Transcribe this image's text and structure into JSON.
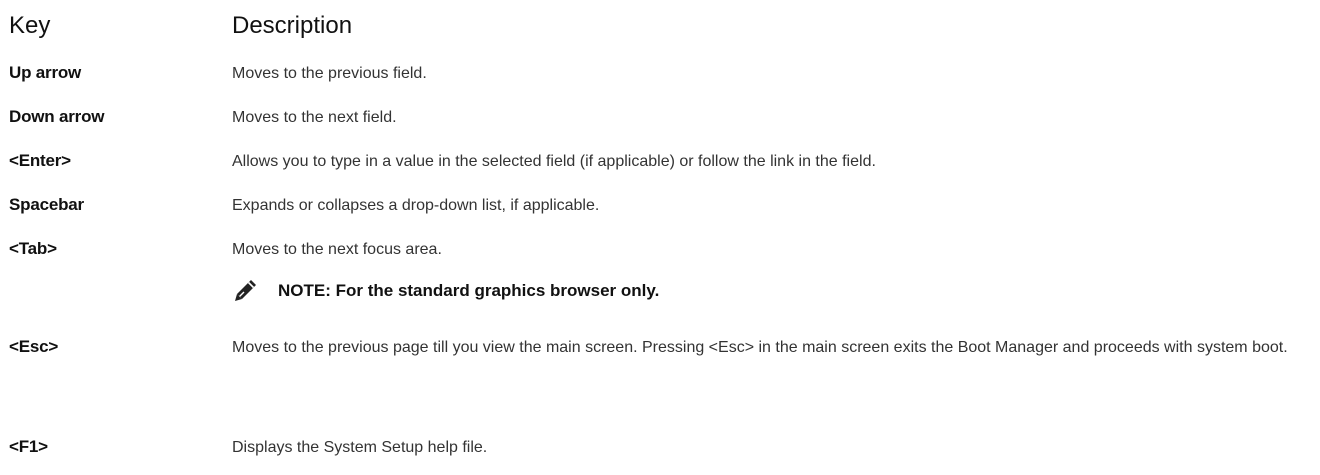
{
  "table": {
    "header": {
      "key": "Key",
      "description": "Description"
    },
    "rows": [
      {
        "key": "Up arrow",
        "description": "Moves to the previous field."
      },
      {
        "key": "Down arrow",
        "description": "Moves to the next field."
      },
      {
        "key": "<Enter>",
        "description": "Allows you to type in a value in the selected field (if applicable) or follow the link in the field."
      },
      {
        "key": "Spacebar",
        "description": "Expands or collapses a drop-down list, if applicable."
      },
      {
        "key": "<Tab>",
        "description": "Moves to the next focus area.",
        "note": "NOTE: For the standard graphics browser only."
      },
      {
        "key": "<Esc>",
        "description": "Moves to the previous page till you view the main screen. Pressing <Esc> in the main screen exits the Boot Manager and proceeds with system boot."
      },
      {
        "key": "<F1>",
        "description": "Displays the System Setup help file."
      }
    ]
  },
  "icons": {
    "note": "pencil-note-icon"
  }
}
